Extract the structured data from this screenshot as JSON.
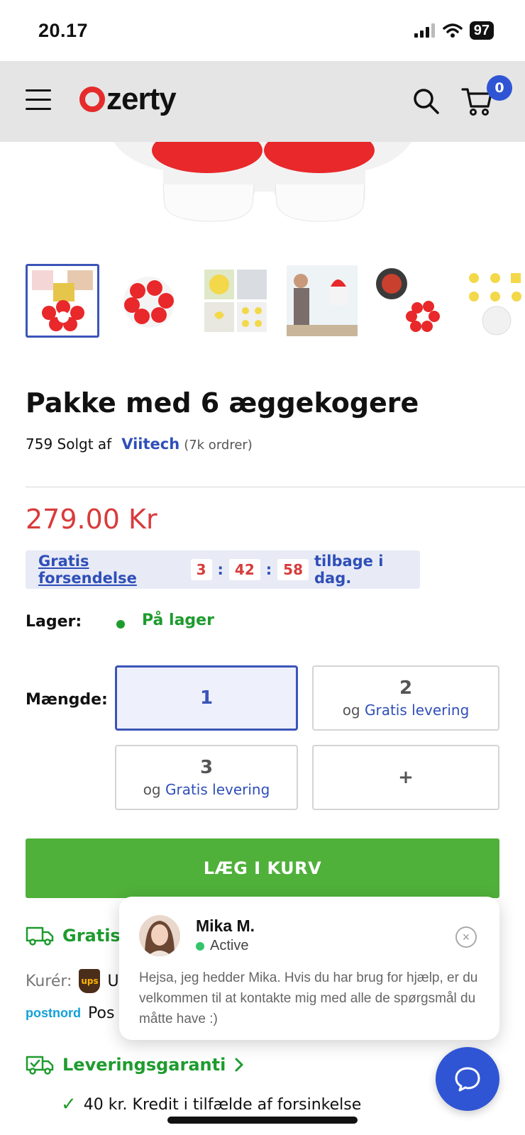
{
  "status_bar": {
    "time": "20.17",
    "battery": "97"
  },
  "header": {
    "logo_text": "zerty",
    "cart_count": "0"
  },
  "thumbnails": [
    "thumb-1",
    "thumb-2",
    "thumb-3",
    "thumb-4",
    "thumb-5",
    "thumb-6"
  ],
  "product": {
    "title": "Pakke med 6 æggekogere",
    "sold_count": "759 Solgt af",
    "seller": "Viitech",
    "seller_orders": "(7k ordrer)",
    "price": "279.00 Kr"
  },
  "shipping_banner": {
    "link": "Gratis forsendelse",
    "hours": "3",
    "minutes": "42",
    "seconds": "58",
    "sep": ":",
    "suffix": "tilbage i dag."
  },
  "stock": {
    "label": "Lager:",
    "value": "På lager"
  },
  "quantity": {
    "label": "Mængde:",
    "options": [
      {
        "num": "1",
        "prefix": "",
        "sub": ""
      },
      {
        "num": "2",
        "prefix": "og ",
        "sub": "Gratis levering"
      },
      {
        "num": "3",
        "prefix": "og ",
        "sub": "Gratis levering"
      },
      {
        "num": "+",
        "prefix": "",
        "sub": ""
      }
    ]
  },
  "cta": {
    "add_to_cart": "LÆG I KURV"
  },
  "delivery": {
    "free_label": "Gratis",
    "courier_label": "Kurér:",
    "courier_tail": "U",
    "ups": "ups",
    "postnord_logo": "postnord",
    "postnord_tail": "Pos",
    "guarantee": "Leveringsgaranti",
    "credit": "40 kr. Kredit i tilfælde af forsinkelse"
  },
  "chat": {
    "name": "Mika M.",
    "status": "Active",
    "message": "Hejsa, jeg hedder Mika. Hvis du har brug for hjælp, er du velkommen til at kontakte mig med alle de spørgsmål du måtte have :)",
    "close": "×"
  },
  "colors": {
    "accent_blue": "#2f55d4",
    "price_red": "#d93b3b",
    "success_green": "#1e9b2e",
    "cta_green": "#4fb03a"
  },
  "icons": [
    "menu-icon",
    "search-icon",
    "cart-icon",
    "truck-icon",
    "truck-check-icon",
    "chevron-right-icon",
    "check-icon",
    "close-icon",
    "chat-bubble-icon"
  ]
}
